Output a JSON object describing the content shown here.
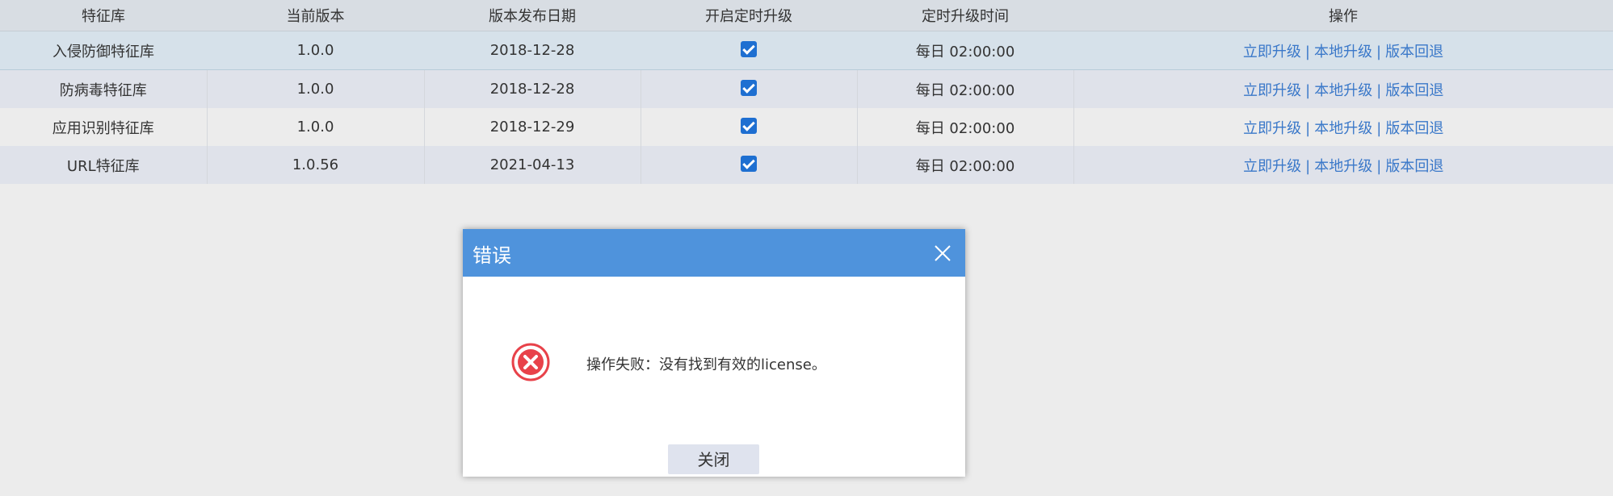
{
  "table": {
    "headers": [
      "特征库",
      "当前版本",
      "版本发布日期",
      "开启定时升级",
      "定时升级时间",
      "操作"
    ],
    "rows": [
      {
        "name": "入侵防御特征库",
        "version": "1.0.0",
        "date": "2018-12-28",
        "auto_upgrade": true,
        "schedule": "每日 02:00:00"
      },
      {
        "name": "防病毒特征库",
        "version": "1.0.0",
        "date": "2018-12-28",
        "auto_upgrade": true,
        "schedule": "每日 02:00:00"
      },
      {
        "name": "应用识别特征库",
        "version": "1.0.0",
        "date": "2018-12-29",
        "auto_upgrade": true,
        "schedule": "每日 02:00:00"
      },
      {
        "name": "URL特征库",
        "version": "1.0.56",
        "date": "2021-04-13",
        "auto_upgrade": true,
        "schedule": "每日 02:00:00"
      }
    ],
    "actions": {
      "upgrade_now": "立即升级",
      "local_upgrade": "本地升级",
      "rollback": "版本回退",
      "separator": "|"
    }
  },
  "dialog": {
    "title": "错误",
    "message": "操作失败：没有找到有效的license。",
    "close_button": "关闭"
  },
  "colors": {
    "header_bg": "#d8dde3",
    "dialog_header": "#4f93dc",
    "link": "#3a78c9",
    "error_red": "#e8424a",
    "checkbox": "#1e6fd1"
  },
  "icons": {
    "close": "close-icon",
    "error": "error-icon",
    "check": "checkbox-checked-icon"
  }
}
